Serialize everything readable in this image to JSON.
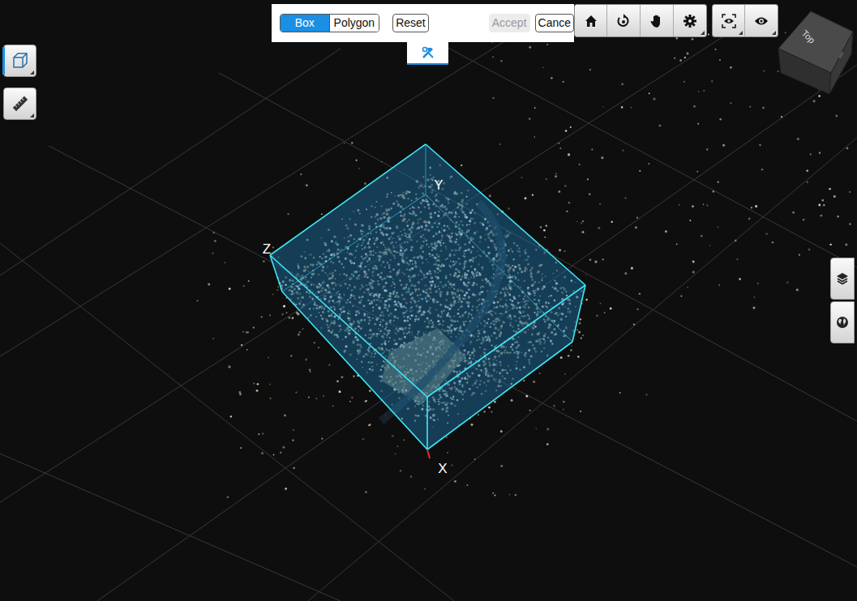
{
  "selection_toolbar": {
    "modes": [
      {
        "label": "Box",
        "selected": true
      },
      {
        "label": "Polygon",
        "selected": false
      }
    ],
    "buttons": [
      {
        "label": "Reset",
        "disabled": false
      },
      {
        "label": "Accept",
        "disabled": true
      },
      {
        "label": "Cance",
        "disabled": false
      }
    ],
    "tool_tab": {
      "selected": true
    }
  },
  "left_tools": [
    {
      "name": "volume",
      "selected": true
    },
    {
      "name": "measure",
      "selected": false
    }
  ],
  "axis_labels": [
    {
      "label": "Y"
    },
    {
      "label": "Z"
    },
    {
      "label": "X"
    }
  ],
  "nav_cube": {
    "label": "Top"
  }
}
